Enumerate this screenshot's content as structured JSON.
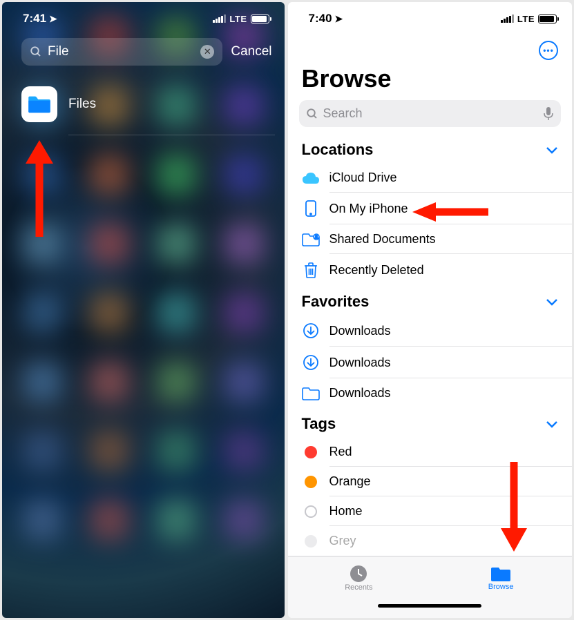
{
  "left": {
    "time": "7:41",
    "network": "LTE",
    "search_value": "File",
    "cancel_label": "Cancel",
    "result_app_name": "Files"
  },
  "right": {
    "time": "7:40",
    "network": "LTE",
    "page_title": "Browse",
    "search_placeholder": "Search",
    "sections": {
      "locations": {
        "title": "Locations",
        "items": [
          {
            "label": "iCloud Drive",
            "icon": "cloud"
          },
          {
            "label": "On My iPhone",
            "icon": "phone"
          },
          {
            "label": "Shared Documents",
            "icon": "shared-folder"
          },
          {
            "label": "Recently Deleted",
            "icon": "trash"
          }
        ]
      },
      "favorites": {
        "title": "Favorites",
        "items": [
          {
            "label": "Downloads",
            "icon": "download"
          },
          {
            "label": "Downloads",
            "icon": "download"
          },
          {
            "label": "Downloads",
            "icon": "folder"
          }
        ]
      },
      "tags": {
        "title": "Tags",
        "items": [
          {
            "label": "Red",
            "color": "#ff3b30"
          },
          {
            "label": "Orange",
            "color": "#ff9500"
          },
          {
            "label": "Home",
            "color": "outline"
          },
          {
            "label": "Grey",
            "color": "#c7c7cc"
          }
        ]
      }
    },
    "tabs": {
      "recents": "Recents",
      "browse": "Browse"
    }
  },
  "colors": {
    "accent": "#0a7aff",
    "arrow": "#ff1a00"
  }
}
